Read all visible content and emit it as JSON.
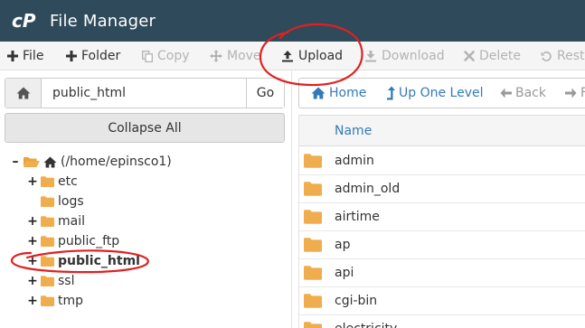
{
  "app": {
    "title": "File Manager",
    "logo": "cP"
  },
  "toolbar": {
    "items": [
      {
        "label": "File",
        "icon": "plus-icon",
        "enabled": true
      },
      {
        "label": "Folder",
        "icon": "plus-icon",
        "enabled": true
      },
      {
        "label": "Copy",
        "icon": "copy-icon",
        "enabled": false
      },
      {
        "label": "Move",
        "icon": "move-icon",
        "enabled": false
      },
      {
        "label": "Upload",
        "icon": "upload-icon",
        "enabled": true
      },
      {
        "label": "Download",
        "icon": "download-icon",
        "enabled": false
      },
      {
        "label": "Delete",
        "icon": "delete-icon",
        "enabled": false
      },
      {
        "label": "Resto",
        "icon": "restore-icon",
        "enabled": false
      }
    ]
  },
  "location": {
    "value": "public_html",
    "go_label": "Go"
  },
  "collapse_label": "Collapse All",
  "tree": {
    "root": "(/home/epinsco1)",
    "items": [
      {
        "label": "etc",
        "toggle": "+"
      },
      {
        "label": "logs",
        "toggle": ""
      },
      {
        "label": "mail",
        "toggle": "+"
      },
      {
        "label": "public_ftp",
        "toggle": "+"
      },
      {
        "label": "public_html",
        "toggle": "+",
        "selected": true
      },
      {
        "label": "ssl",
        "toggle": "+"
      },
      {
        "label": "tmp",
        "toggle": "+"
      }
    ]
  },
  "nav": {
    "home": "Home",
    "up": "Up One Level",
    "back": "Back",
    "forward": "F"
  },
  "list": {
    "column": "Name",
    "rows": [
      "admin",
      "admin_old",
      "airtime",
      "ap",
      "api",
      "cgi-bin",
      "electricity"
    ]
  },
  "colors": {
    "header": "#2f4a5a",
    "link": "#337ab7",
    "folder": "#f0ad4e",
    "annotation": "#e02020"
  }
}
